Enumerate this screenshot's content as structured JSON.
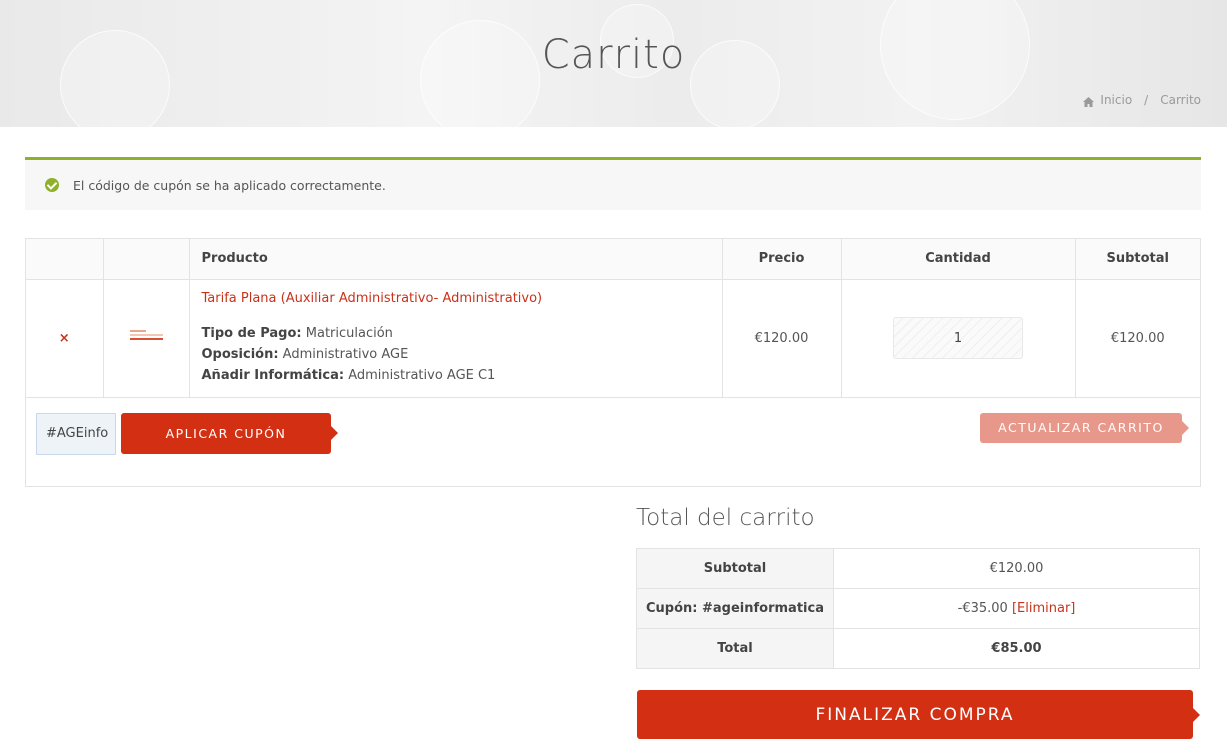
{
  "header": {
    "title": "Carrito"
  },
  "breadcrumb": {
    "home": "Inicio",
    "separator": "/",
    "current": "Carrito"
  },
  "notice": {
    "message": "El código de cupón se ha aplicado correctamente."
  },
  "table": {
    "headers": {
      "product": "Producto",
      "price": "Precio",
      "quantity": "Cantidad",
      "subtotal": "Subtotal"
    },
    "item": {
      "remove": "×",
      "name": "Tarifa Plana (Auxiliar Administrativo- Administrativo)",
      "meta": [
        {
          "label": "Tipo de Pago:",
          "value": "Matriculación"
        },
        {
          "label": "Oposición:",
          "value": "Administrativo AGE"
        },
        {
          "label": "Añadir Informática:",
          "value": "Administrativo AGE C1"
        }
      ],
      "price": "€120.00",
      "quantity": "1",
      "subtotal": "€120.00"
    }
  },
  "coupon": {
    "value": "#AGEinfo",
    "apply_label": "Aplicar cupón"
  },
  "update_label": "Actualizar carrito",
  "totals": {
    "title": "Total del carrito",
    "subtotal_label": "Subtotal",
    "subtotal_value": "€120.00",
    "coupon_label": "Cupón: #ageinformatica",
    "coupon_value": "-€35.00",
    "coupon_remove": "[Eliminar]",
    "total_label": "Total",
    "total_value": "€85.00"
  },
  "checkout_label": "Finalizar compra",
  "colors": {
    "accent": "#d32f13",
    "success": "#8fb02b",
    "link": "#c9321a",
    "update_disabled": "#e8988a"
  }
}
